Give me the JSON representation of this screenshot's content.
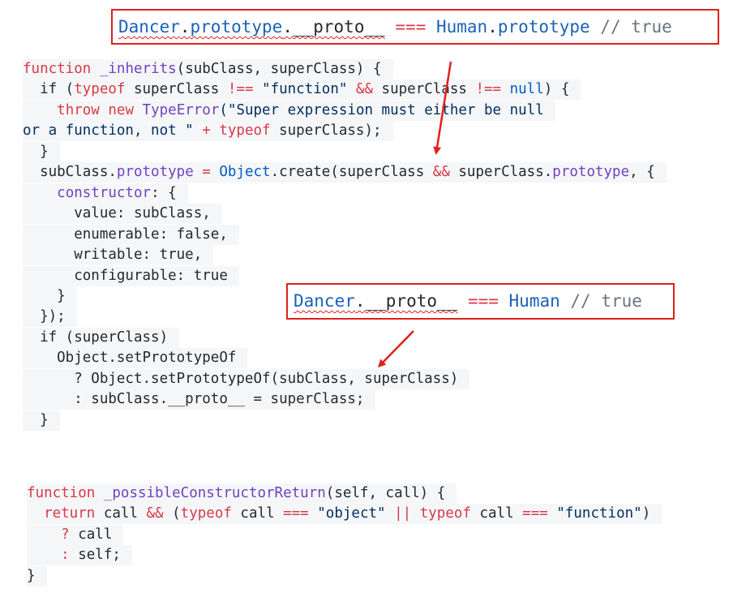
{
  "callout_top": {
    "obj": "Dancer",
    "dot1": ".",
    "prop": "prototype",
    "dot2": ".",
    "proto": "__proto__",
    "op": " === ",
    "rhs_obj": "Human",
    "dot3": ".",
    "rhs_prop": "prototype",
    "comment": " // true"
  },
  "callout_mid": {
    "obj": "Dancer",
    "dot": ".",
    "proto": "__proto__",
    "op": " === ",
    "rhs": "Human",
    "comment": " // true"
  },
  "code_inherits": {
    "l1": {
      "kw": "function",
      "sp": " ",
      "name": "_inherits",
      "rest": "(subClass, superClass) {"
    },
    "l2": {
      "a": "  if (",
      "typeof": "typeof",
      "b": " superClass ",
      "neq": "!==",
      "c": " ",
      "s": "\"function\"",
      "d": " ",
      "and": "&&",
      "e": " superClass ",
      "neq2": "!==",
      "f": " ",
      "null": "null",
      "g": ") {"
    },
    "l3": {
      "a": "    ",
      "throw": "throw",
      "b": " ",
      "new": "new",
      "c": " ",
      "te": "TypeError",
      "s": "(\"Super expression must either be null"
    },
    "l4": {
      "s": "or a function, not \"",
      "a": " ",
      "plus": "+",
      "b": " ",
      "typeof": "typeof",
      "c": " superClass);"
    },
    "l5": "  }",
    "l6": {
      "a": "  subClass.",
      "proto": "prototype",
      "b": " ",
      "eq": "=",
      "c": " ",
      "obj": "Object",
      "d": ".create(superClass ",
      "and": "&&",
      "e": " superClass.",
      "proto2": "prototype",
      "f": ", {"
    },
    "l7": {
      "a": "    ",
      "ctor": "constructor",
      "b": ": {"
    },
    "l8": "      value: subClass,",
    "l9": "      enumerable: false,",
    "l10": "      writable: true,",
    "l11": "      configurable: true",
    "l12": "    }",
    "l13": "  });",
    "l14": "  if (superClass)",
    "l15": "    Object.setPrototypeOf",
    "l16": "      ? Object.setPrototypeOf(subClass, superClass)",
    "l17": "      : subClass.__proto__ = superClass;",
    "l18": "  }"
  },
  "code_possible": {
    "l1": {
      "kw": "function",
      "sp": " ",
      "name": "_possibleConstructorReturn",
      "rest": "(self, call) {"
    },
    "l2": {
      "a": "  ",
      "ret": "return",
      "b": " call ",
      "and": "&&",
      "c": " (",
      "t1": "typeof",
      "d": " call ",
      "eq1": "===",
      "e": " ",
      "s1": "\"object\"",
      "f": " ",
      "or": "||",
      "g": " ",
      "t2": "typeof",
      "h": " call ",
      "eq2": "===",
      "i": " ",
      "s2": "\"function\"",
      "j": ")"
    },
    "l3": {
      "a": "    ",
      "q": "?",
      "b": " call"
    },
    "l4": {
      "a": "    ",
      "c": ":",
      "b": " self;"
    },
    "l5": "}"
  }
}
